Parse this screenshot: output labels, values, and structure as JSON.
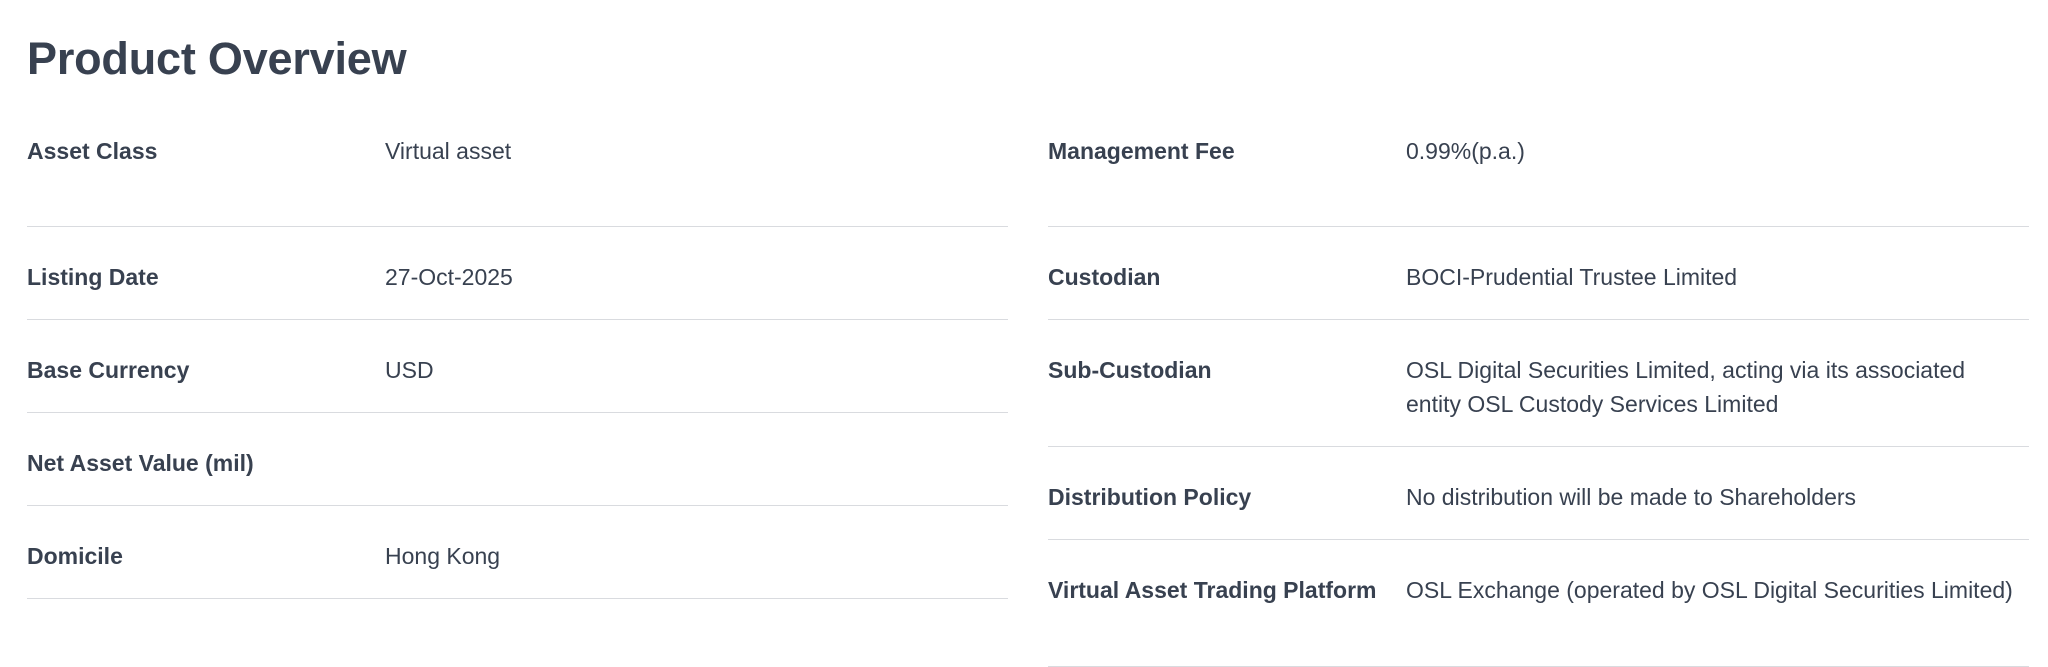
{
  "title": "Product Overview",
  "left_rows": [
    {
      "label": "Asset Class",
      "value": "Virtual asset"
    },
    {
      "label": "Listing Date",
      "value": "27-Oct-2025"
    },
    {
      "label": "Base Currency",
      "value": "USD"
    },
    {
      "label": "Net Asset Value (mil)",
      "value": ""
    },
    {
      "label": "Domicile",
      "value": "Hong Kong"
    }
  ],
  "right_rows": [
    {
      "label": "Management Fee",
      "value": "0.99%(p.a.)"
    },
    {
      "label": "Custodian",
      "value": "BOCI-Prudential Trustee Limited"
    },
    {
      "label": "Sub-Custodian",
      "value": "OSL Digital Securities Limited, acting via its associated entity OSL Custody Services Limited"
    },
    {
      "label": "Distribution Policy",
      "value": "No distribution will be made to Shareholders"
    },
    {
      "label": "Virtual Asset Trading Platform",
      "value": "OSL Exchange (operated by OSL Digital Securities Limited)"
    }
  ]
}
